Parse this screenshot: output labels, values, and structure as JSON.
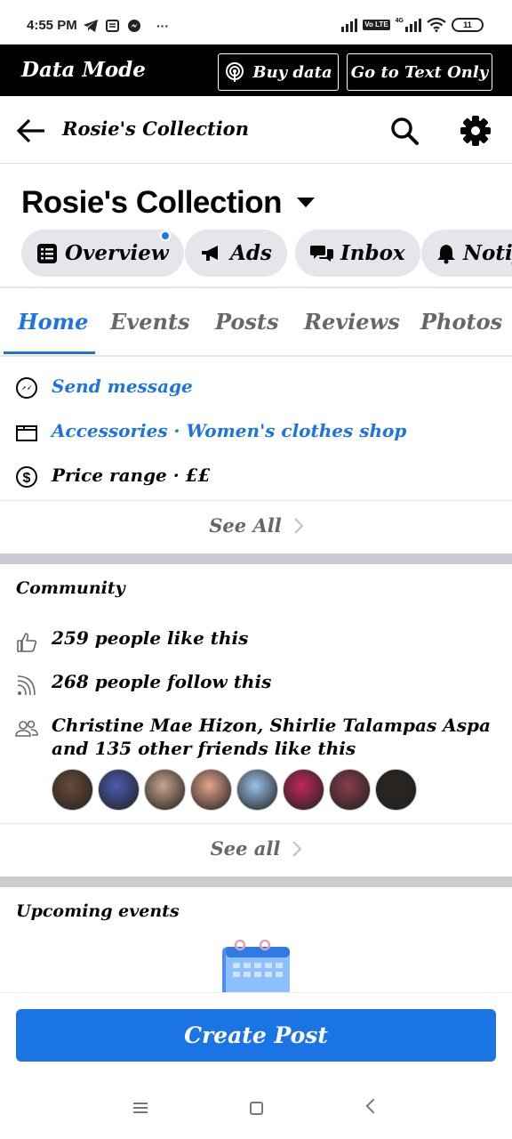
{
  "status_bar": {
    "time": "4:55 PM",
    "ellipsis": "···",
    "lte_label": "Vo LTE",
    "net_label": "4G",
    "battery": "11"
  },
  "data_mode": {
    "title": "Data Mode",
    "buy_label": "Buy data",
    "text_only_label": "Go to Text Only"
  },
  "header": {
    "title": "Rosie's Collection"
  },
  "page": {
    "name": "Rosie's Collection",
    "pills": [
      {
        "label": "Overview",
        "icon": "list-icon"
      },
      {
        "label": "Ads",
        "icon": "megaphone-icon"
      },
      {
        "label": "Inbox",
        "icon": "chat-bubbles-icon"
      },
      {
        "label": "Notif",
        "icon": "bell-icon"
      }
    ]
  },
  "tabs": [
    "Home",
    "Events",
    "Posts",
    "Reviews",
    "Photos"
  ],
  "info": {
    "send_message": "Send message",
    "category": "Accessories · Women's clothes shop",
    "price_range": "Price range · ££",
    "see_all": "See All"
  },
  "community": {
    "title": "Community",
    "likes": "259 people like this",
    "follows": "268 people follow this",
    "friends": "Christine Mae Hizon, Shirlie Talampas Aspa and 135 other friends like this",
    "avatars": [
      "#6b4a3a",
      "#4b5bb0",
      "#c7a38a",
      "#e6a48b",
      "#9ac3e8",
      "#c2275c",
      "#8a3d4a",
      "#2a2520"
    ],
    "see_all": "See all"
  },
  "events": {
    "title": "Upcoming events"
  },
  "create_post": {
    "label": "Create Post"
  },
  "colors": {
    "accent": "#1b74e4",
    "pill_bg": "#e4e6eb",
    "band": "#c9ccd1"
  }
}
